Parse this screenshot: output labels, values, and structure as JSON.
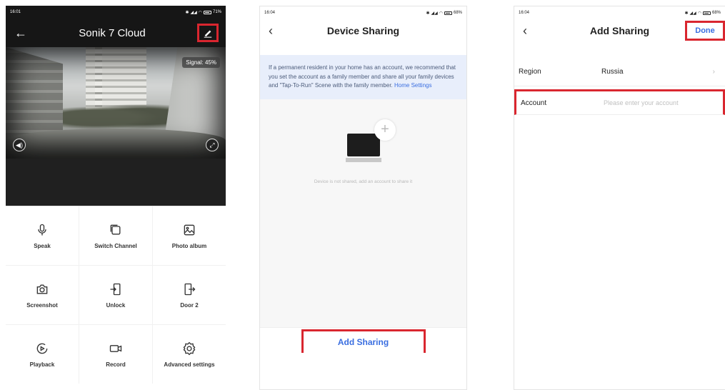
{
  "screen1": {
    "status": {
      "time": "16:01",
      "battery": "71%"
    },
    "title": "Sonik 7 Cloud",
    "signal": "Signal: 45%",
    "actions": [
      {
        "label": "Speak",
        "icon": "microphone-icon"
      },
      {
        "label": "Switch Channel",
        "icon": "switch-channel-icon"
      },
      {
        "label": "Photo album",
        "icon": "photo-album-icon"
      },
      {
        "label": "Screenshot",
        "icon": "camera-icon"
      },
      {
        "label": "Unlock",
        "icon": "unlock-door-icon"
      },
      {
        "label": "Door 2",
        "icon": "door-icon"
      },
      {
        "label": "Playback",
        "icon": "playback-icon"
      },
      {
        "label": "Record",
        "icon": "record-video-icon"
      },
      {
        "label": "Advanced settings",
        "icon": "gear-icon"
      }
    ]
  },
  "screen2": {
    "status": {
      "time": "16:04",
      "battery": "68%"
    },
    "title": "Device Sharing",
    "notice_text": "If a permanent resident in your home has an account, we recommend that you set the account as a family member and share all your family devices and \"Tap-To-Run\" Scene with the family member.",
    "notice_link": "Home Settings",
    "empty_text": "Device is not shared, add an account to share it",
    "add_button": "Add Sharing"
  },
  "screen3": {
    "status": {
      "time": "16:04",
      "battery": "68%"
    },
    "title": "Add Sharing",
    "done": "Done",
    "region_label": "Region",
    "region_value": "Russia",
    "account_label": "Account",
    "account_placeholder": "Please enter your account"
  },
  "colors": {
    "highlight": "#d9262f",
    "link": "#3a6ee0"
  }
}
